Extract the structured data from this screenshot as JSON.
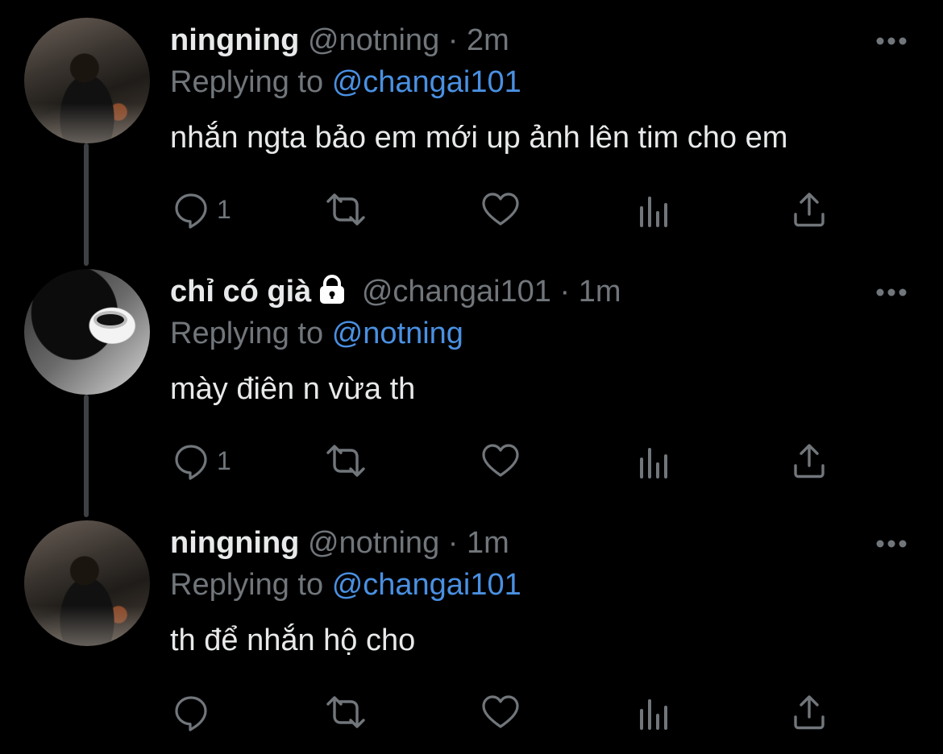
{
  "colors": {
    "background": "#000000",
    "text": "#e7e9ea",
    "muted": "#71767b",
    "mention": "#4a90e2",
    "thread_line": "#3e4144"
  },
  "tweets": [
    {
      "name": "ningning",
      "handle": "@notning",
      "separator": "·",
      "time": "2m",
      "locked": false,
      "replying_label": "Replying to",
      "replying_to": "@changai101",
      "text": "nhắn ngta bảo em mới up ảnh lên tim cho em",
      "reply_count": "1",
      "icons": [
        "reply-icon",
        "retweet-icon",
        "like-icon",
        "analytics-icon",
        "share-icon",
        "more-icon"
      ]
    },
    {
      "name": "chỉ có già",
      "handle": "@changai101",
      "separator": "·",
      "time": "1m",
      "locked": true,
      "replying_label": "Replying to",
      "replying_to": "@notning",
      "text": "mày điên n vừa th",
      "reply_count": "1",
      "icons": [
        "reply-icon",
        "retweet-icon",
        "like-icon",
        "analytics-icon",
        "share-icon",
        "more-icon"
      ]
    },
    {
      "name": "ningning",
      "handle": "@notning",
      "separator": "·",
      "time": "1m",
      "locked": false,
      "replying_label": "Replying to",
      "replying_to": "@changai101",
      "text": "th để nhắn hộ cho",
      "reply_count": "",
      "icons": [
        "reply-icon",
        "retweet-icon",
        "like-icon",
        "analytics-icon",
        "share-icon",
        "more-icon"
      ]
    }
  ]
}
